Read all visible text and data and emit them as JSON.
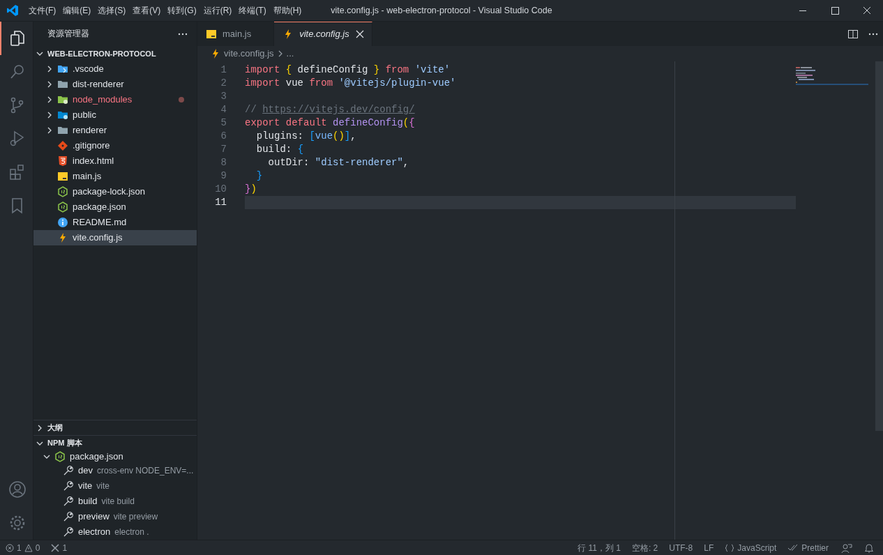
{
  "window": {
    "title": "vite.config.js - web-electron-protocol - Visual Studio Code",
    "menu": [
      "文件(F)",
      "编辑(E)",
      "选择(S)",
      "查看(V)",
      "转到(G)",
      "运行(R)",
      "终端(T)",
      "帮助(H)"
    ]
  },
  "activity_bar": [
    {
      "kind": "explorer",
      "selected": true
    },
    {
      "kind": "search",
      "selected": false
    },
    {
      "kind": "source-control",
      "selected": false
    },
    {
      "kind": "run",
      "selected": false
    },
    {
      "kind": "extensions",
      "selected": false
    },
    {
      "kind": "bookmark",
      "selected": false
    }
  ],
  "sidebar": {
    "title": "资源管理器",
    "project": {
      "name": "WEB-ELECTRON-PROTOCOL",
      "expanded": true
    },
    "items": [
      {
        "label": ".vscode",
        "kind": "vscode-folder",
        "expanded": false,
        "selected": false,
        "modified": false
      },
      {
        "label": "dist-renderer",
        "kind": "folder",
        "expanded": false,
        "selected": false,
        "modified": false
      },
      {
        "label": "node_modules",
        "kind": "node-folder",
        "expanded": false,
        "selected": false,
        "modified": true
      },
      {
        "label": "public",
        "kind": "public-folder",
        "expanded": false,
        "selected": false,
        "modified": false
      },
      {
        "label": "renderer",
        "kind": "folder",
        "expanded": false,
        "selected": false,
        "modified": false
      },
      {
        "label": ".gitignore",
        "kind": "git-file",
        "selected": false,
        "modified": false
      },
      {
        "label": "index.html",
        "kind": "html-file",
        "selected": false,
        "modified": false
      },
      {
        "label": "main.js",
        "kind": "js-file",
        "selected": false,
        "modified": false
      },
      {
        "label": "package-lock.json",
        "kind": "json-file",
        "selected": false,
        "modified": false
      },
      {
        "label": "package.json",
        "kind": "json-file",
        "selected": false,
        "modified": false
      },
      {
        "label": "README.md",
        "kind": "readme-file",
        "selected": false,
        "modified": false
      },
      {
        "label": "vite.config.js",
        "kind": "vite-file",
        "selected": true,
        "modified": false
      }
    ],
    "outline": {
      "title": "大纲",
      "expanded": false
    },
    "npm_scripts": {
      "title": "NPM 脚本",
      "expanded": true,
      "package": "package.json",
      "scripts": [
        {
          "name": "dev",
          "command": "cross-env NODE_ENV=..."
        },
        {
          "name": "vite",
          "command": "vite"
        },
        {
          "name": "build",
          "command": "vite build"
        },
        {
          "name": "preview",
          "command": "vite preview"
        },
        {
          "name": "electron",
          "command": "electron ."
        }
      ]
    }
  },
  "editor": {
    "tabs": [
      {
        "label": "main.js",
        "kind": "js-file",
        "selected": false
      },
      {
        "label": "vite.config.js",
        "kind": "vite-file",
        "selected": true
      }
    ],
    "breadcrumb": [
      "vite.config.js",
      "..."
    ],
    "lines": [
      {
        "number": "1",
        "current": false,
        "tokens": [
          {
            "text": "import ",
            "kind": "keyword"
          },
          {
            "text": "{",
            "kind": "bracket1"
          },
          {
            "text": " defineConfig ",
            "kind": "plain"
          },
          {
            "text": "}",
            "kind": "bracket1"
          },
          {
            "text": " from ",
            "kind": "keyword"
          },
          {
            "text": "'vite'",
            "kind": "string"
          }
        ]
      },
      {
        "number": "2",
        "current": false,
        "tokens": [
          {
            "text": "import ",
            "kind": "keyword"
          },
          {
            "text": "vue ",
            "kind": "plain"
          },
          {
            "text": "from ",
            "kind": "keyword"
          },
          {
            "text": "'@vitejs/plugin-vue'",
            "kind": "string"
          }
        ]
      },
      {
        "number": "3",
        "current": false
      },
      {
        "number": "4",
        "current": false,
        "tokens": [
          {
            "text": "// ",
            "kind": "comment"
          },
          {
            "text": "https://vitejs.dev/config/",
            "kind": "link"
          }
        ]
      },
      {
        "number": "5",
        "current": false,
        "tokens": [
          {
            "text": "export default ",
            "kind": "keyword"
          },
          {
            "text": "defineConfig",
            "kind": "function"
          },
          {
            "text": "(",
            "kind": "bracket1"
          },
          {
            "text": "{",
            "kind": "bracket2"
          }
        ]
      },
      {
        "number": "6",
        "current": false,
        "tokens": [
          {
            "text": "  plugins: ",
            "kind": "plain"
          },
          {
            "text": "[",
            "kind": "bracket3"
          },
          {
            "text": "vue",
            "kind": "call"
          },
          {
            "text": "()",
            "kind": "bracket1"
          },
          {
            "text": "]",
            "kind": "bracket3"
          },
          {
            "text": ",",
            "kind": "plain"
          }
        ]
      },
      {
        "number": "7",
        "current": false,
        "tokens": [
          {
            "text": "  build: ",
            "kind": "plain"
          },
          {
            "text": "{",
            "kind": "bracket3"
          }
        ]
      },
      {
        "number": "8",
        "current": false,
        "tokens": [
          {
            "text": "    outDir: ",
            "kind": "plain"
          },
          {
            "text": "\"dist-renderer\"",
            "kind": "string"
          },
          {
            "text": ",",
            "kind": "plain"
          }
        ]
      },
      {
        "number": "9",
        "current": false,
        "tokens": [
          {
            "text": "  }",
            "kind": "bracket3"
          }
        ]
      },
      {
        "number": "10",
        "current": false,
        "tokens": [
          {
            "text": "}",
            "kind": "bracket2"
          },
          {
            "text": ")",
            "kind": "bracket1"
          }
        ]
      },
      {
        "number": "11",
        "current": true
      }
    ]
  },
  "status_bar": {
    "errors": "1",
    "warnings": "0",
    "ports": "1",
    "items": [
      {
        "label": "行 11，列 1",
        "kind": "text"
      },
      {
        "label": "空格: 2",
        "kind": "text"
      },
      {
        "label": "UTF-8",
        "kind": "text"
      },
      {
        "label": "LF",
        "kind": "text"
      },
      {
        "label": "JavaScript",
        "kind": "language"
      },
      {
        "label": "Prettier",
        "kind": "formatter"
      }
    ]
  }
}
